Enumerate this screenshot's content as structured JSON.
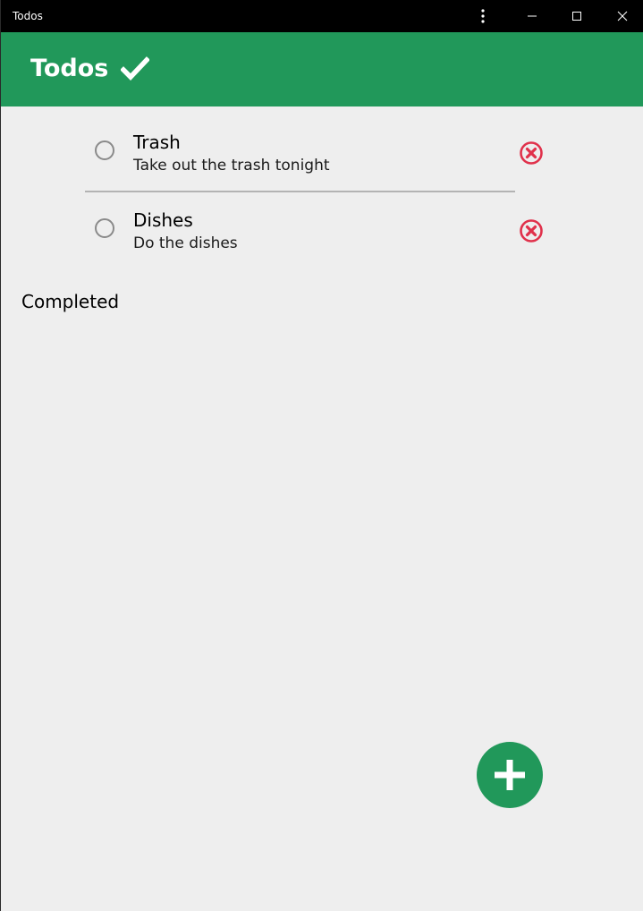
{
  "window": {
    "title": "Todos",
    "controls": [
      "more-icon",
      "minimize-icon",
      "maximize-icon",
      "close-icon"
    ]
  },
  "appbar": {
    "title": "Todos",
    "icon": "checkmark-icon",
    "color": "#21985a"
  },
  "todos": [
    {
      "title": "Trash",
      "description": "Take out the trash tonight",
      "completed": false
    },
    {
      "title": "Dishes",
      "description": "Do the dishes",
      "completed": false
    }
  ],
  "completed_section": {
    "heading": "Completed",
    "items": []
  },
  "fab": {
    "icon": "plus-icon",
    "color": "#21985a"
  },
  "colors": {
    "accent": "#21985a",
    "delete": "#e0314b",
    "background": "#eeeeee"
  }
}
